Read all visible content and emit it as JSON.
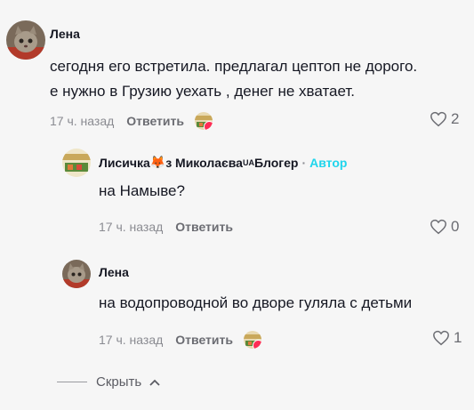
{
  "comments": [
    {
      "author": "Лена",
      "lines": [
        "сегодня его встретила. предлагал цептоп не дорого.",
        "е нужно в Грузию уехать , денег не хватает."
      ],
      "time": "17 ч. назад",
      "reply_label": "Ответить",
      "likes": "2",
      "avatar_icon": "kitten-avatar"
    }
  ],
  "replies": [
    {
      "author_prefix": "Лисичка",
      "author_emoji": "🦊",
      "author_middle": "з Миколаєва",
      "author_flag": "UA",
      "author_suffix": "Блогер",
      "dot": "·",
      "badge": "Автор",
      "text": "на Намыве?",
      "time": "17 ч. назад",
      "reply_label": "Ответить",
      "likes": "0",
      "avatar_icon": "shop-avatar"
    },
    {
      "author": "Лена",
      "text": "на водопроводной во дворе гуляла с детьми",
      "time": "17 ч. назад",
      "reply_label": "Ответить",
      "likes": "1",
      "avatar_icon": "kitten-avatar"
    }
  ],
  "hide_label": "Скрыть",
  "colors": {
    "author_badge": "#20d5ec",
    "like_badge": "#fe2c55",
    "background": "#f6f6f6"
  }
}
